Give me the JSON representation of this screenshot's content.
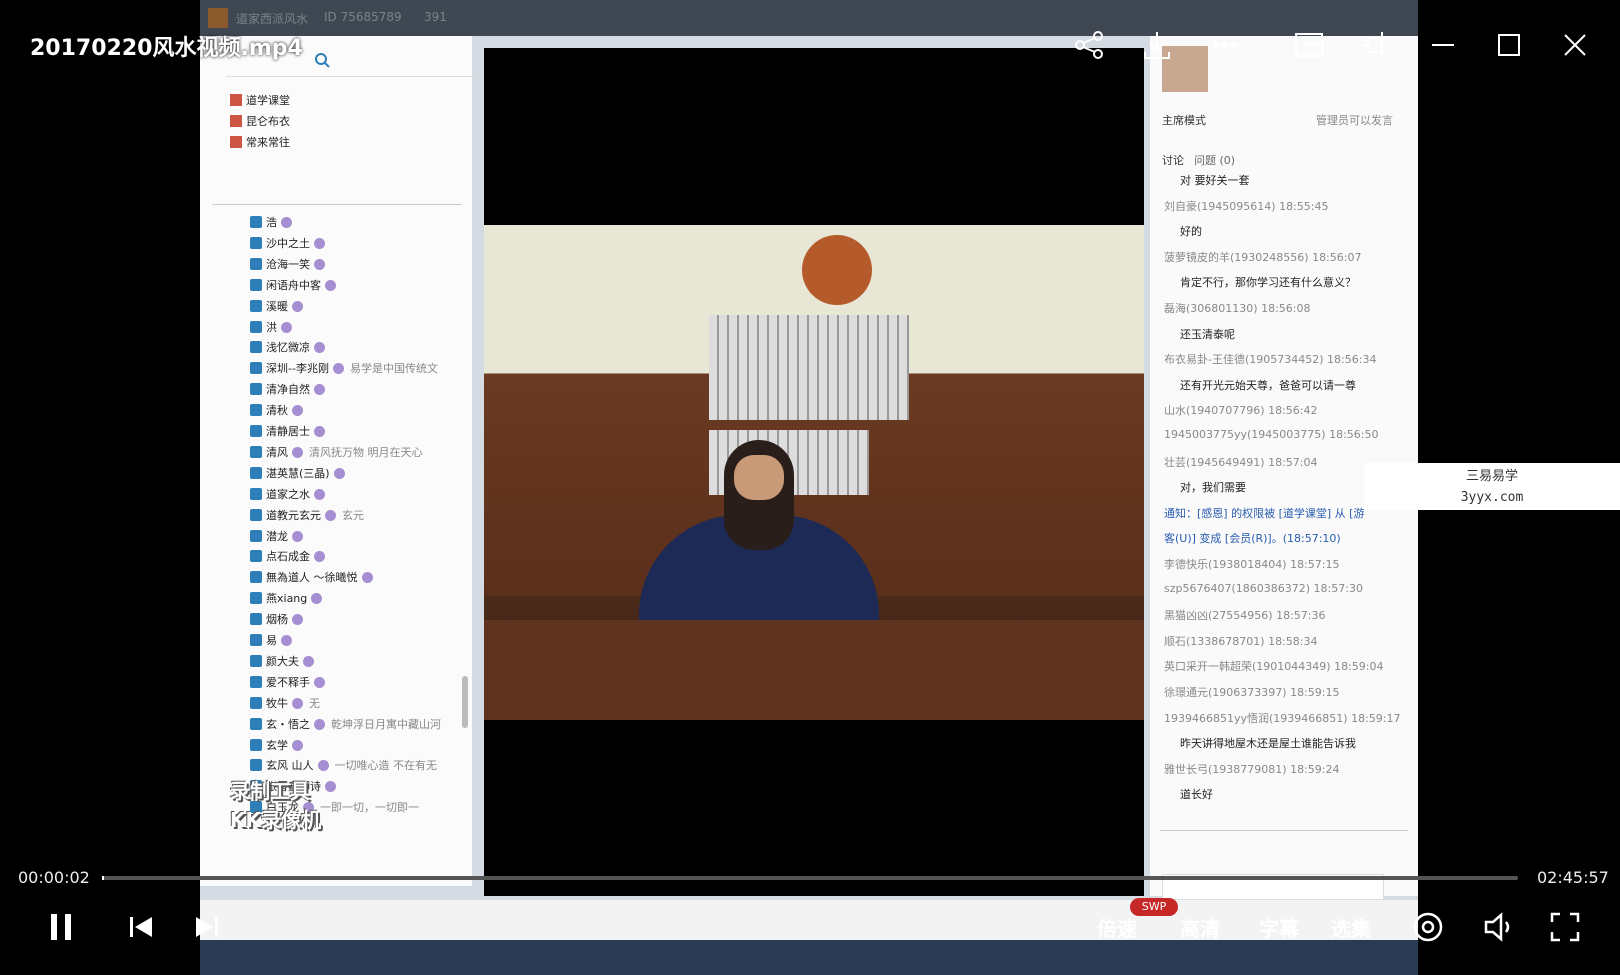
{
  "player": {
    "title": "20170220风水视频.mp4",
    "current_time": "00:00:02",
    "total_time": "02:45:57",
    "progress": 0.0002,
    "controls": {
      "speed_label": "倍速",
      "quality_label": "高清",
      "quality_badge": "SWP",
      "subtitle_label": "字幕",
      "episodes_label": "选集"
    }
  },
  "recording": {
    "window_title": "道家西派风水",
    "window_id": "ID 75685789",
    "window_count": "391",
    "groups": [
      "道学课堂",
      "昆仑布衣",
      "常来常往"
    ],
    "members": [
      {
        "name": "浩"
      },
      {
        "name": "沙中之土"
      },
      {
        "name": "沧海一笑"
      },
      {
        "name": "闲语舟中客"
      },
      {
        "name": "溪暖"
      },
      {
        "name": "洪"
      },
      {
        "name": "浅忆微凉"
      },
      {
        "name": "深圳--李兆刚",
        "note": "易学是中国传统文"
      },
      {
        "name": "清净自然"
      },
      {
        "name": "清秋"
      },
      {
        "name": "清静居士"
      },
      {
        "name": "清风",
        "note": "清风抚万物  明月在天心"
      },
      {
        "name": "湛英慧(三晶)"
      },
      {
        "name": "道家之水"
      },
      {
        "name": "道教元玄元",
        "note": "玄元"
      },
      {
        "name": "潜龙"
      },
      {
        "name": "点石成金"
      },
      {
        "name": "無為道人 ～徐曦悦"
      },
      {
        "name": "燕xiang"
      },
      {
        "name": "烟杨"
      },
      {
        "name": "易"
      },
      {
        "name": "颜大夫"
      },
      {
        "name": "爱不释手"
      },
      {
        "name": "牧牛",
        "note": "无"
      },
      {
        "name": "玄・悟之",
        "note": "乾坤浮日月寓中藏山河"
      },
      {
        "name": "玄学"
      },
      {
        "name": "玄风 山人",
        "note": "一切唯心造 不在有无"
      },
      {
        "name": "张晋鑫卿诗"
      },
      {
        "name": "白玉龙",
        "note": "一即一切，一切即一"
      }
    ],
    "watermark_stamp": [
      "录制工具",
      "KK录像机"
    ],
    "chat": {
      "mode_label": "主席模式",
      "admin_note": "管理员可以发言",
      "tab_discuss": "讨论",
      "tab_questions": "问题 (0)",
      "messages": [
        {
          "kind": "text",
          "text": "对 要好关一套"
        },
        {
          "kind": "meta",
          "text": "刘自豪(1945095614) 18:55:45"
        },
        {
          "kind": "text",
          "text": "好的"
        },
        {
          "kind": "meta",
          "text": "菠萝镜皮的羊(1930248556) 18:56:07"
        },
        {
          "kind": "text",
          "text": "肯定不行，那你学习还有什么意义？"
        },
        {
          "kind": "meta",
          "text": "磊海(306801130) 18:56:08"
        },
        {
          "kind": "text",
          "text": "还玉清泰呢"
        },
        {
          "kind": "meta",
          "text": "布衣易卦-王佳德(1905734452) 18:56:34"
        },
        {
          "kind": "text",
          "text": "还有开光元始天尊，爸爸可以请一尊"
        },
        {
          "kind": "meta",
          "text": "山水(1940707796) 18:56:42"
        },
        {
          "kind": "meta",
          "text": "1945003775yy(1945003775) 18:56:50"
        },
        {
          "kind": "meta",
          "text": "壮芸(1945649491) 18:57:04"
        },
        {
          "kind": "text",
          "text": "对，我们需要"
        },
        {
          "kind": "notice",
          "text": "通知：[感恩] 的权限被 [道学课堂] 从 [游"
        },
        {
          "kind": "notice",
          "text": "客(U)] 变成 [会员(R)]。(18:57:10)"
        },
        {
          "kind": "meta",
          "text": "李德快乐(1938018404) 18:57:15"
        },
        {
          "kind": "meta",
          "text": "szp5676407(1860386372) 18:57:30"
        },
        {
          "kind": "meta",
          "text": "黑猫凶凶(27554956) 18:57:36"
        },
        {
          "kind": "meta",
          "text": "顺石(1338678701) 18:58:34"
        },
        {
          "kind": "meta",
          "text": "英口采开一韩超荣(1901044349) 18:59:04"
        },
        {
          "kind": "meta",
          "text": "徐璟通元(1906373397) 18:59:15"
        },
        {
          "kind": "meta",
          "text": "1939466851yy悟润(1939466851) 18:59:17"
        },
        {
          "kind": "text",
          "text": "昨天讲得地屋木还是屋土谁能告诉我"
        },
        {
          "kind": "meta",
          "text": "雅世长弓(1938779081) 18:59:24"
        },
        {
          "kind": "text",
          "text": "道长好"
        }
      ]
    },
    "site_watermark": {
      "line1": "三易易学",
      "line2": "3yyx.com"
    }
  },
  "colors": {
    "accent": "#c62828",
    "background": "#000000"
  }
}
